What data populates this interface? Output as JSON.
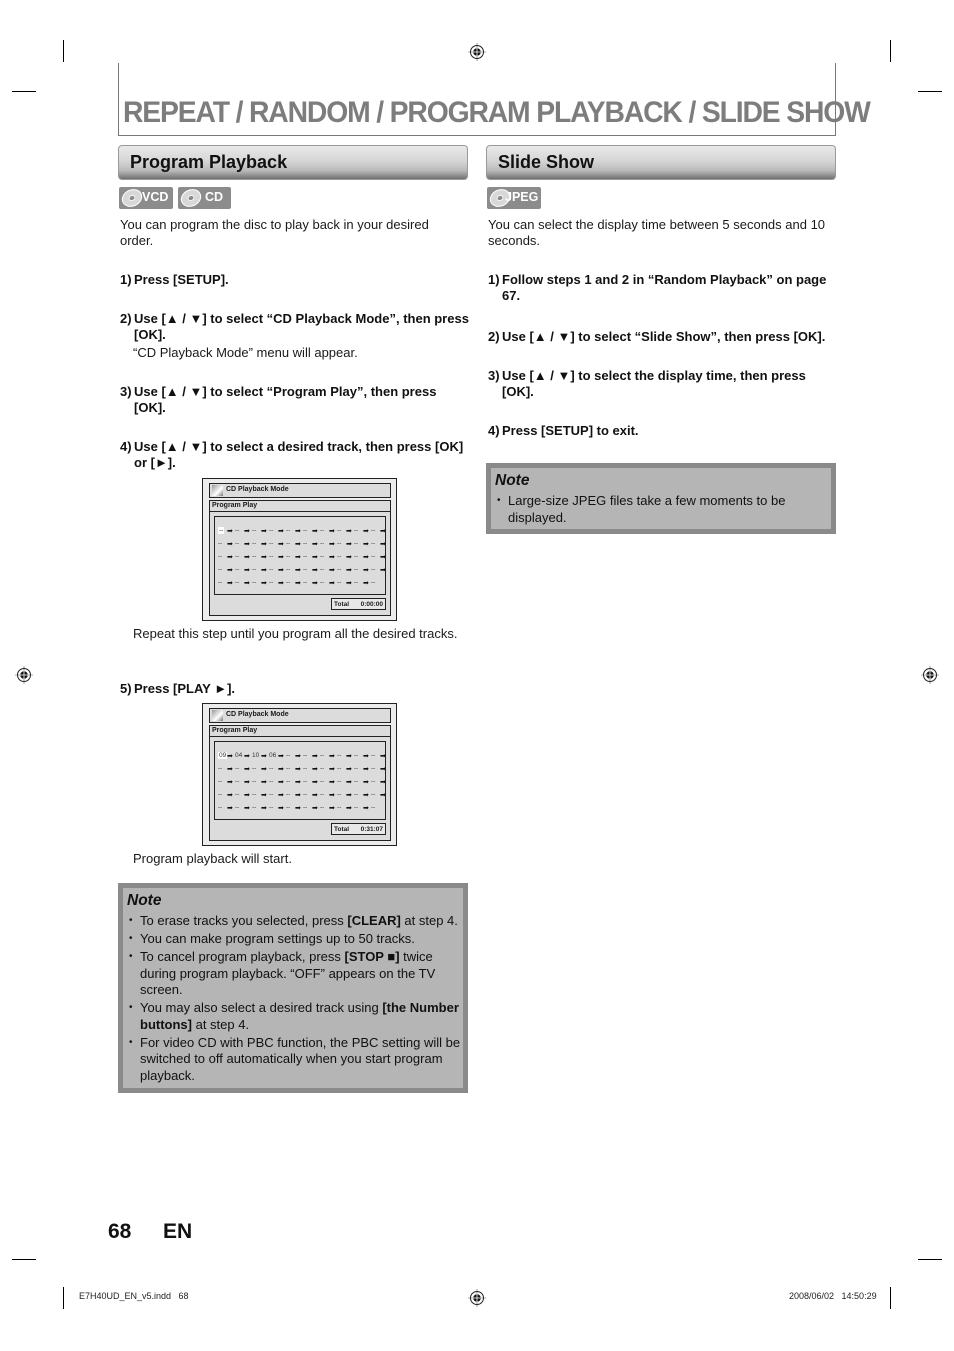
{
  "page": {
    "title": "REPEAT / RANDOM / PROGRAM PLAYBACK / SLIDE SHOW",
    "page_number": "68",
    "language": "EN",
    "footer_file": "E7H40UD_EN_v5.indd   68",
    "footer_timestamp": "2008/06/02   14:50:29"
  },
  "program_playback": {
    "heading": "Program Playback",
    "badges": [
      {
        "icon": "disc-icon",
        "label": "VCD"
      },
      {
        "icon": "disc-icon",
        "label": "CD"
      }
    ],
    "intro": "You can program the disc to play back in your desired order.",
    "steps": [
      {
        "num": "1)",
        "text": "Press [SETUP]."
      },
      {
        "num": "2)",
        "text": "Use [▲ / ▼] to select “CD Playback Mode”, then press [OK].",
        "detail": "“CD Playback Mode” menu will appear."
      },
      {
        "num": "3)",
        "text": "Use [▲ / ▼] to select “Program Play”, then press [OK]."
      },
      {
        "num": "4)",
        "text": "Use [▲ / ▼] to select a desired track, then press [OK] or [►].",
        "detail": "Repeat this step until you program all the desired tracks."
      },
      {
        "num": "5)",
        "text": "Press [PLAY ►].",
        "detail": "Program playback will start."
      }
    ],
    "screens": [
      {
        "menu_title": "CD Playback Mode",
        "submenu": "Program Play",
        "tracks": [
          "--",
          "",
          "",
          "",
          "",
          "",
          "",
          "",
          "",
          "",
          "",
          "",
          "",
          "",
          "",
          "",
          "",
          "",
          "",
          "",
          "",
          "",
          "",
          "",
          "",
          "",
          "",
          "",
          "",
          "",
          "",
          "",
          "",
          "",
          "",
          "",
          "",
          "",
          "",
          "",
          "",
          "",
          "",
          "",
          "",
          "",
          "",
          "",
          "",
          ""
        ],
        "total_label": "Total",
        "total_time": "0:00:00"
      },
      {
        "menu_title": "CD Playback Mode",
        "submenu": "Program Play",
        "tracks": [
          "09",
          "04",
          "10",
          "06"
        ],
        "total_label": "Total",
        "total_time": "0:31:07"
      }
    ],
    "note": {
      "heading": "Note",
      "items": [
        {
          "parts": [
            {
              "t": "To erase tracks you selected, press "
            },
            {
              "t": "[CLEAR]",
              "b": true
            },
            {
              "t": " at step 4."
            }
          ]
        },
        {
          "parts": [
            {
              "t": "You can make program settings up to 50 tracks."
            }
          ]
        },
        {
          "parts": [
            {
              "t": "To cancel program playback, press "
            },
            {
              "t": "[STOP ■]",
              "b": true
            },
            {
              "t": " twice during program playback. “OFF” appears on the TV screen."
            }
          ]
        },
        {
          "parts": [
            {
              "t": "You may also select a desired track using "
            },
            {
              "t": "[the Number buttons]",
              "b": true
            },
            {
              "t": " at step 4."
            }
          ]
        },
        {
          "parts": [
            {
              "t": "For video CD with PBC function, the PBC setting will be switched to off automatically when you start program playback."
            }
          ]
        }
      ]
    }
  },
  "slide_show": {
    "heading": "Slide Show",
    "badges": [
      {
        "icon": "disc-icon",
        "label": "JPEG"
      }
    ],
    "intro": "You can select the display time between 5 seconds and 10 seconds.",
    "steps": [
      {
        "num": "1)",
        "text": "Follow steps 1 and 2 in “Random Playback” on page 67."
      },
      {
        "num": "2)",
        "text": "Use [▲ / ▼] to select “Slide Show”, then press [OK]."
      },
      {
        "num": "3)",
        "text": "Use [▲ / ▼] to select the display time, then press [OK]."
      },
      {
        "num": "4)",
        "text": "Press [SETUP] to exit."
      }
    ],
    "note": {
      "heading": "Note",
      "items": [
        {
          "parts": [
            {
              "t": "Large-size JPEG files take a few moments to be displayed."
            }
          ]
        }
      ]
    }
  },
  "grid": {
    "empty_slot": "--",
    "arrow": "➡",
    "slots_total": 50,
    "slots_per_row": 10
  }
}
